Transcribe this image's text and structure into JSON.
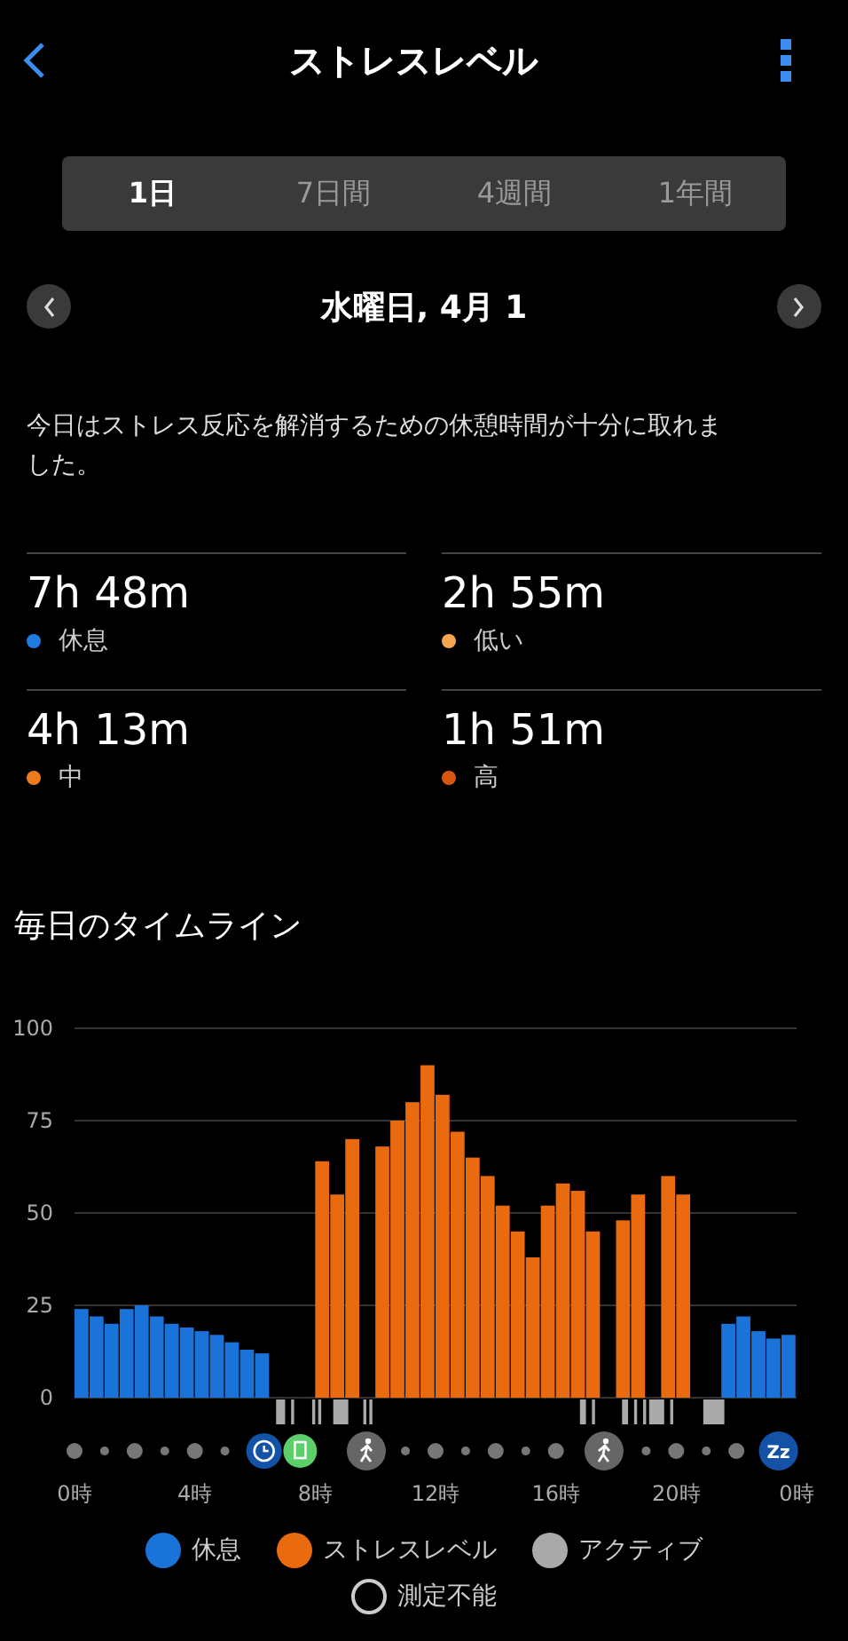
{
  "header": {
    "title": "ストレスレベル"
  },
  "tabs": [
    {
      "label": "1日",
      "selected": true
    },
    {
      "label": "7日間",
      "selected": false
    },
    {
      "label": "4週間",
      "selected": false
    },
    {
      "label": "1年間",
      "selected": false
    }
  ],
  "date": {
    "label": "水曜日, 4月 1"
  },
  "message": "今日はストレス反応を解消するための休憩時間が十分に取れました。",
  "stats": [
    {
      "value": "7h 48m",
      "label": "休息",
      "color": "#1e7be0"
    },
    {
      "value": "2h 55m",
      "label": "低い",
      "color": "#f7a64f"
    },
    {
      "value": "4h 13m",
      "label": "中",
      "color": "#ef7b1f"
    },
    {
      "value": "1h 51m",
      "label": "高",
      "color": "#d9560f"
    }
  ],
  "timeline": {
    "title": "毎日のタイムライン",
    "chart_data": {
      "type": "bar",
      "grid": true,
      "x": [
        0,
        0.5,
        1,
        1.5,
        2,
        2.5,
        3,
        3.5,
        4,
        4.5,
        5,
        5.5,
        6,
        6.5,
        7,
        7.5,
        8,
        8.5,
        9,
        9.5,
        10,
        10.5,
        11,
        11.5,
        12,
        12.5,
        13,
        13.5,
        14,
        14.5,
        15,
        15.5,
        16,
        16.5,
        17,
        17.5,
        18,
        18.5,
        19,
        19.5,
        20,
        20.5,
        21,
        21.5,
        22,
        22.5,
        23,
        23.5
      ],
      "series": [
        {
          "name": "休息",
          "color": "#1a73d9",
          "values": [
            24,
            22,
            20,
            24,
            25,
            22,
            20,
            19,
            18,
            17,
            15,
            13,
            12,
            null,
            null,
            null,
            null,
            null,
            null,
            null,
            null,
            null,
            null,
            null,
            null,
            null,
            null,
            null,
            null,
            null,
            null,
            null,
            null,
            null,
            null,
            null,
            null,
            null,
            null,
            null,
            null,
            null,
            null,
            20,
            22,
            18,
            16,
            17
          ]
        },
        {
          "name": "ストレスレベル",
          "color": "#ea6a0f",
          "values": [
            null,
            null,
            null,
            null,
            null,
            null,
            null,
            null,
            null,
            null,
            null,
            null,
            null,
            null,
            null,
            null,
            64,
            55,
            70,
            null,
            68,
            75,
            80,
            90,
            82,
            72,
            65,
            60,
            52,
            45,
            38,
            52,
            58,
            56,
            45,
            null,
            48,
            55,
            null,
            60,
            55,
            null,
            null,
            null,
            null,
            null,
            null,
            null
          ]
        }
      ],
      "xlim": [
        0,
        24
      ],
      "ylim": [
        0,
        100
      ],
      "yticks": [
        0,
        25,
        50,
        75,
        100
      ],
      "xticks": [
        {
          "value": 0,
          "label": "0時"
        },
        {
          "value": 4,
          "label": "4時"
        },
        {
          "value": 8,
          "label": "8時"
        },
        {
          "value": 12,
          "label": "12時"
        },
        {
          "value": 16,
          "label": "16時"
        },
        {
          "value": 20,
          "label": "20時"
        }
      ]
    },
    "end_label": "0時",
    "events": [
      {
        "kind": "clock"
      },
      {
        "kind": "meal"
      },
      {
        "kind": "walk"
      },
      {
        "kind": "walk"
      },
      {
        "kind": "sleep",
        "label": "Zz"
      }
    ],
    "legend": [
      {
        "kind": "fill",
        "label": "アクティブ",
        "color": "#aaaaaa"
      },
      {
        "kind": "ring",
        "label": "測定不能"
      }
    ]
  }
}
